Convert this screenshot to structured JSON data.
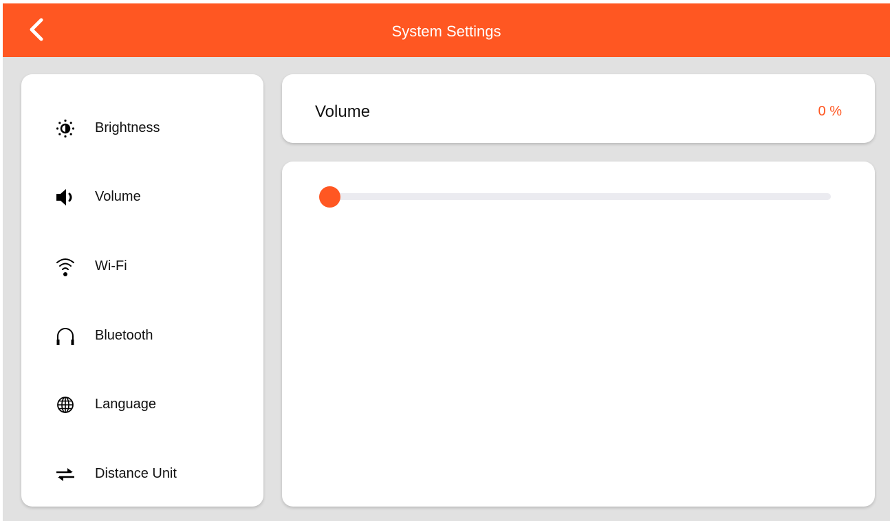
{
  "header": {
    "title": "System Settings",
    "back_icon": "chevron-left-icon"
  },
  "sidebar": {
    "items": [
      {
        "label": "Brightness",
        "icon": "brightness-icon"
      },
      {
        "label": "Volume",
        "icon": "speaker-icon"
      },
      {
        "label": "Wi-Fi",
        "icon": "wifi-icon"
      },
      {
        "label": "Bluetooth",
        "icon": "headphones-icon"
      },
      {
        "label": "Language",
        "icon": "globe-icon"
      },
      {
        "label": "Distance Unit",
        "icon": "swap-arrows-icon"
      }
    ]
  },
  "panel": {
    "title": "Volume",
    "value_text": "0 %",
    "slider_value_percent": 0
  },
  "colors": {
    "accent": "#ff5722",
    "background": "#e1e1e1",
    "card": "#ffffff",
    "track": "#ebebf0"
  }
}
